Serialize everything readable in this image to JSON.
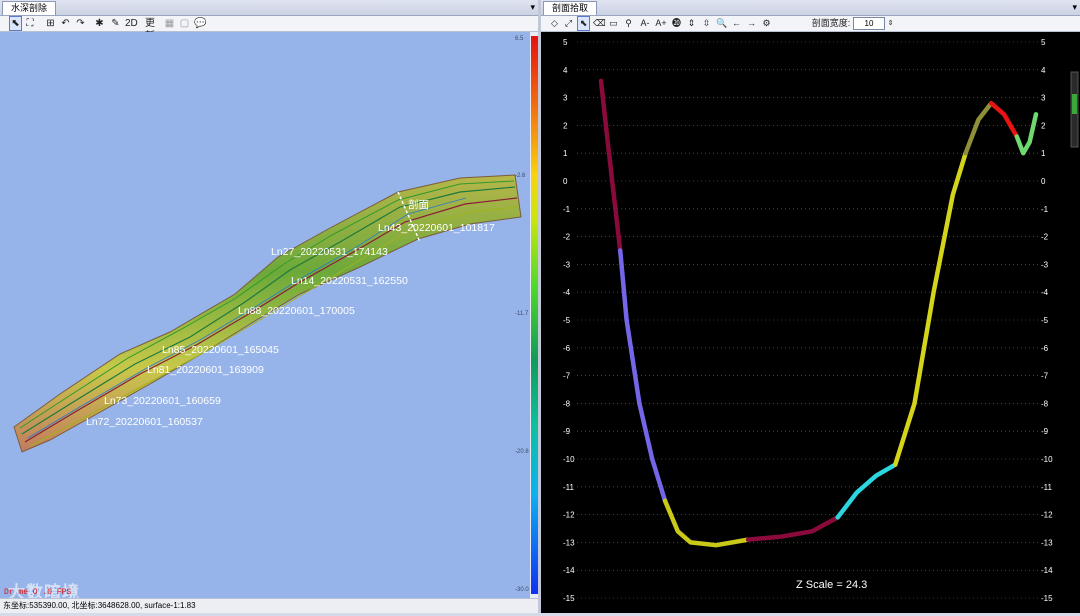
{
  "left": {
    "tab_title": "水深剖除",
    "menu_glyph": "▾",
    "toolbar": {
      "label_2d": "2D",
      "label_refresh": "更新"
    },
    "colorbar": {
      "ticks": [
        "6.5",
        "-2.6",
        "-11.7",
        "-20.8",
        "-30.0"
      ],
      "colors": [
        "#e21111",
        "#f26a10",
        "#f7d410",
        "#c8e510",
        "#4ed82c",
        "#129a5a",
        "#10bfa0",
        "#10b0f0",
        "#1030f0"
      ]
    },
    "profile_marker_label": "剖面",
    "survey_lines": [
      "Ln43_20220601_101817",
      "Ln27_20220531_174143",
      "Ln14_20220531_162550",
      "Ln88_20220601_170005",
      "Ln85_20220601_165045",
      "Ln81_20220601_163909",
      "Ln73_20220601_160659",
      "Ln72_20220601_160537"
    ],
    "overlay_text": "Dr      me      O      .0 FPS",
    "watermark": "大数暗境",
    "status": "东坐标:535390.00, 北坐标:3648628.00, surface-1:1.83"
  },
  "right": {
    "tab_title": "剖面拾取",
    "menu_glyph": "▾",
    "toolbar": {
      "a_minus": "A-",
      "a_plus": "A+",
      "width_label": "剖面宽度:",
      "width_value": "10"
    },
    "profile": {
      "y_ticks": [
        "5",
        "4",
        "3",
        "2",
        "1",
        "0",
        "-1",
        "-2",
        "-3",
        "-4",
        "-5",
        "-6",
        "-7",
        "-8",
        "-9",
        "-10",
        "-11",
        "-12",
        "-13",
        "-14",
        "-15"
      ],
      "z_scale": "Z Scale = 24.3",
      "ylim": [
        -15,
        5
      ],
      "segments": [
        {
          "color": "#8b0a3c",
          "points": [
            [
              0,
              3.6
            ],
            [
              1,
              1.5
            ],
            [
              2,
              -0.5
            ],
            [
              3,
              -2.5
            ]
          ]
        },
        {
          "color": "#7566e8",
          "points": [
            [
              3,
              -2.5
            ],
            [
              4,
              -5
            ],
            [
              6,
              -8
            ],
            [
              8,
              -10
            ],
            [
              10,
              -11.5
            ]
          ]
        },
        {
          "color": "#c9c91a",
          "points": [
            [
              10,
              -11.5
            ],
            [
              12,
              -12.6
            ],
            [
              14,
              -13
            ],
            [
              18,
              -13.1
            ],
            [
              23,
              -12.9
            ]
          ]
        },
        {
          "color": "#8b0a3c",
          "points": [
            [
              23,
              -12.9
            ],
            [
              28,
              -12.8
            ],
            [
              33,
              -12.6
            ],
            [
              37,
              -12.1
            ]
          ]
        },
        {
          "color": "#2bd6e0",
          "points": [
            [
              37,
              -12.1
            ],
            [
              40,
              -11.2
            ],
            [
              43,
              -10.6
            ],
            [
              46,
              -10.2
            ]
          ]
        },
        {
          "color": "#d4d41a",
          "points": [
            [
              46,
              -10.2
            ],
            [
              49,
              -8
            ],
            [
              52,
              -4
            ],
            [
              55,
              -0.5
            ],
            [
              57,
              1
            ]
          ]
        },
        {
          "color": "#8f8f3a",
          "points": [
            [
              57,
              1
            ],
            [
              59,
              2.2
            ],
            [
              61,
              2.8
            ]
          ]
        },
        {
          "color": "#e81414",
          "points": [
            [
              61,
              2.8
            ],
            [
              63,
              2.4
            ],
            [
              65,
              1.6
            ]
          ]
        },
        {
          "color": "#6fd96f",
          "points": [
            [
              65,
              1.6
            ],
            [
              66,
              1
            ],
            [
              67,
              1.4
            ],
            [
              68,
              2.4
            ]
          ]
        }
      ]
    }
  }
}
